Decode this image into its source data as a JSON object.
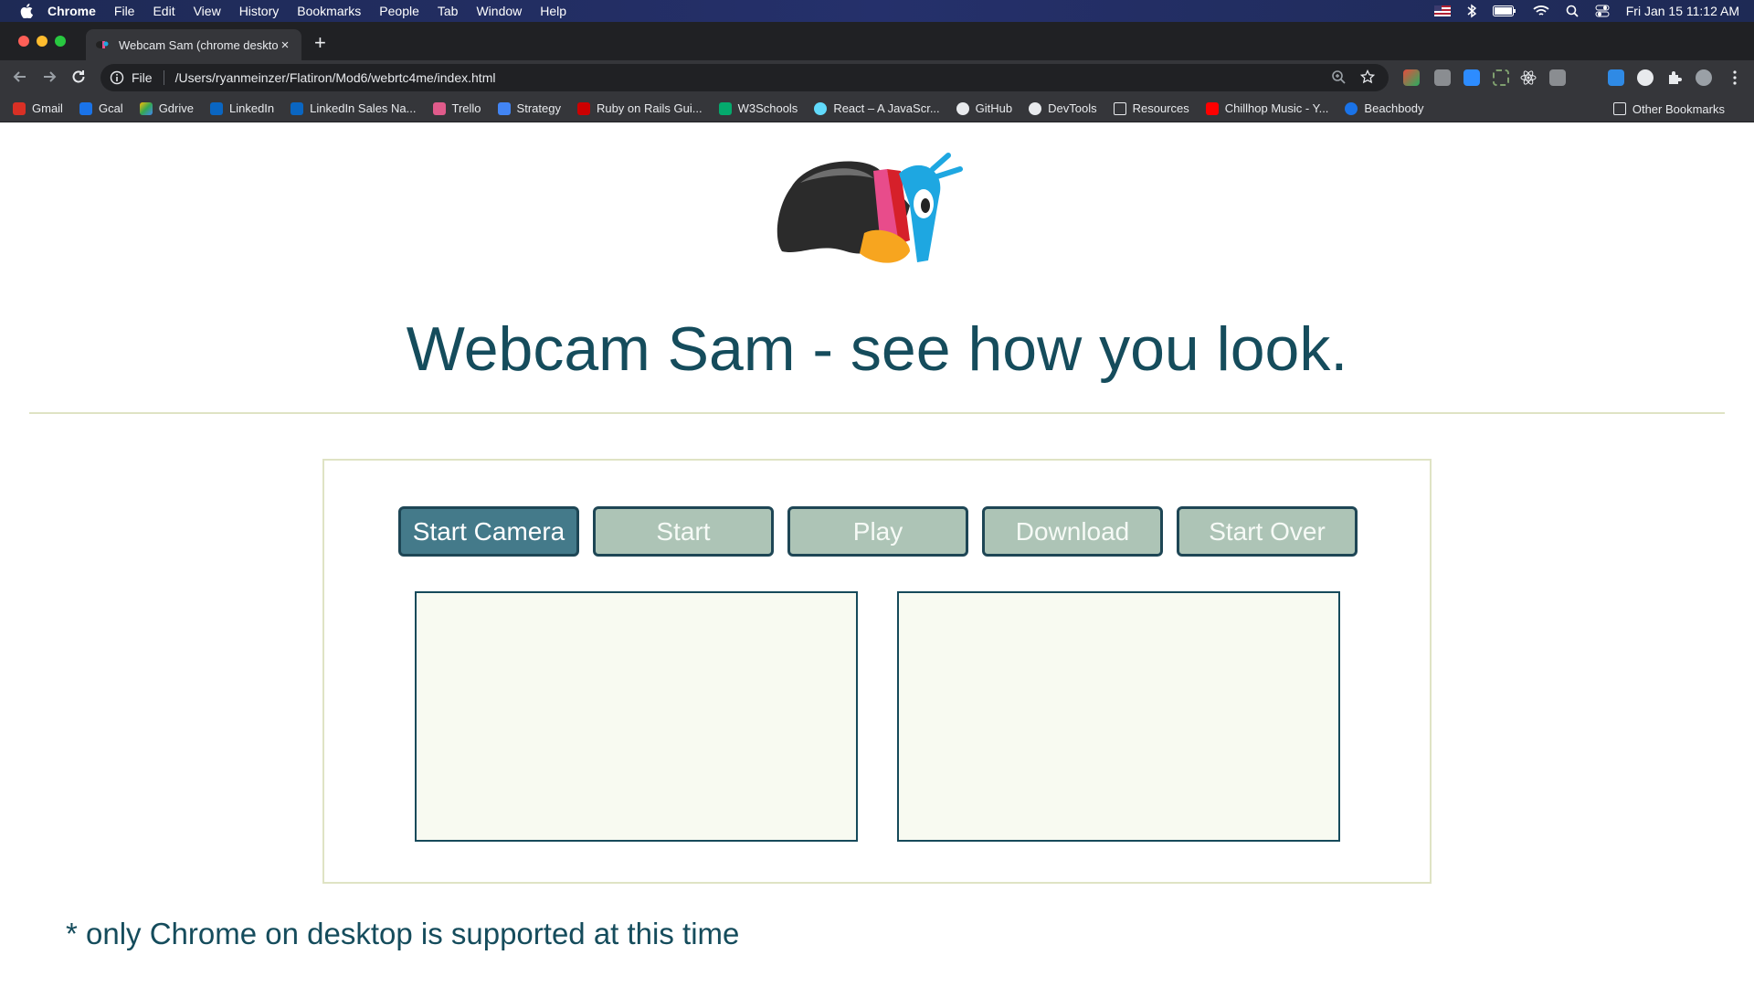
{
  "menubar": {
    "app": "Chrome",
    "items": [
      "File",
      "Edit",
      "View",
      "History",
      "Bookmarks",
      "People",
      "Tab",
      "Window",
      "Help"
    ],
    "clock": "Fri Jan 15  11:12 AM"
  },
  "tab": {
    "title": "Webcam Sam (chrome desktop",
    "close": "×",
    "new_tab": "+"
  },
  "omnibox": {
    "scheme": "File",
    "url": "/Users/ryanmeinzer/Flatiron/Mod6/webrtc4me/index.html"
  },
  "bookmarks": [
    {
      "label": "Gmail",
      "color": "#d93025"
    },
    {
      "label": "Gcal",
      "color": "#1a73e8"
    },
    {
      "label": "Gdrive",
      "color": "#34a853"
    },
    {
      "label": "LinkedIn",
      "color": "#0a66c2"
    },
    {
      "label": "LinkedIn Sales Na...",
      "color": "#0a66c2"
    },
    {
      "label": "Trello",
      "color": "#e05b8b"
    },
    {
      "label": "Strategy",
      "color": "#4285f4"
    },
    {
      "label": "Ruby on Rails Gui...",
      "color": "#cc0000"
    },
    {
      "label": "W3Schools",
      "color": "#04aa6d"
    },
    {
      "label": "React – A JavaScr...",
      "color": "#61dafb"
    },
    {
      "label": "GitHub",
      "color": "#e8eaed"
    },
    {
      "label": "DevTools",
      "color": "#e8eaed"
    },
    {
      "label": "Resources",
      "color": "#9aa0a6"
    },
    {
      "label": "Chillhop Music - Y...",
      "color": "#ff0000"
    },
    {
      "label": "Beachbody",
      "color": "#1a73e8"
    }
  ],
  "other_bookmarks": "Other Bookmarks",
  "page": {
    "heading": "Webcam Sam - see how you look.",
    "buttons": {
      "start_camera": "Start Camera",
      "start": "Start",
      "play": "Play",
      "download": "Download",
      "start_over": "Start Over"
    },
    "note": "* only Chrome on desktop is supported at this time"
  },
  "colors": {
    "heading": "#154c5c",
    "button_active": "#447a8a",
    "button_disabled": "#adc4b6",
    "video_bg": "#f8faf1",
    "rule": "#dfe3c4"
  }
}
